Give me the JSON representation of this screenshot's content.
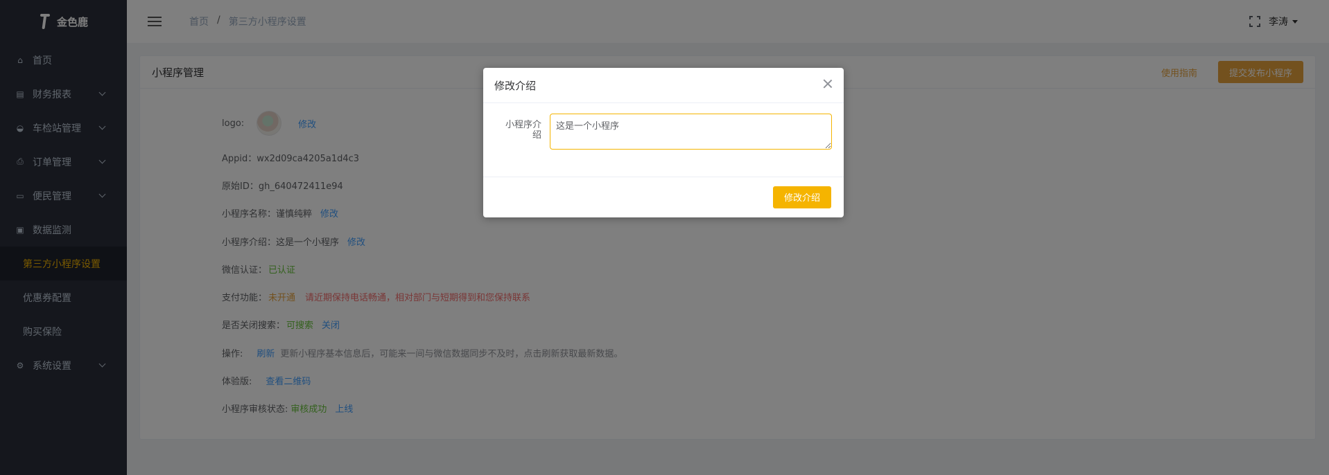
{
  "brand": {
    "name": "金色鹿"
  },
  "sidebar": {
    "items": [
      {
        "label": "首页",
        "icon": "home-icon"
      },
      {
        "label": "财务报表",
        "icon": "report-icon"
      },
      {
        "label": "车检站管理",
        "icon": "station-icon"
      },
      {
        "label": "订单管理",
        "icon": "order-icon"
      },
      {
        "label": "便民管理",
        "icon": "service-icon"
      },
      {
        "label": "数据监测",
        "icon": "calendar-icon"
      },
      {
        "label": "第三方小程序设置"
      },
      {
        "label": "优惠券配置"
      },
      {
        "label": "购买保险"
      },
      {
        "label": "系统设置",
        "icon": "gear-icon"
      }
    ],
    "active_color": "#f5b400"
  },
  "header": {
    "breadcrumb": {
      "home": "首页",
      "separator": "/",
      "current": "第三方小程序设置"
    },
    "user": "李涛"
  },
  "card": {
    "title": "小程序管理",
    "guide_link": "使用指南",
    "submit_button": "提交发布小程序"
  },
  "info": {
    "logo_label": "logo:",
    "logo_edit": "修改",
    "appid": "Appid：wx2d09ca4205a1d4c3",
    "origin_id": "原始ID：gh_640472411e94",
    "name_label": "小程序名称：",
    "name_value": "谨慎纯粹",
    "name_edit": "修改",
    "intro_label": "小程序介绍：",
    "intro_value": "这是一个小程序",
    "intro_edit": "修改",
    "wechat_label": "微信认证：",
    "wechat_value": "已认证",
    "pay_label": "支付功能：",
    "pay_status": "未开通",
    "pay_notice": "请近期保持电话畅通，相对部门与短期得到和您保持联系",
    "search_label": "是否关闭搜索：",
    "search_status": "可搜索",
    "search_close": "关闭",
    "op_label": "操作:",
    "op_refresh": "刷新",
    "op_hint": "更新小程序基本信息后，可能来一间与微信数据同步不及时，点击刷新获取最新数据。",
    "trial_label": "体验版:",
    "trial_link": "查看二维码",
    "audit_label": "小程序审核状态:",
    "audit_status": "审核成功",
    "audit_online": "上线"
  },
  "dialog": {
    "title": "修改介绍",
    "field_label": "小程序介绍",
    "field_value": "这是一个小程序",
    "confirm_button": "修改介绍"
  }
}
